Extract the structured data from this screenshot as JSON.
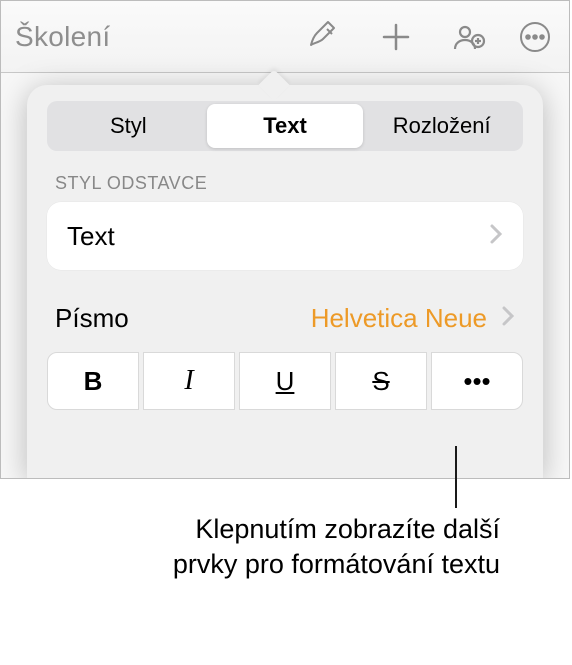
{
  "toolbar": {
    "doc_title": "Školení"
  },
  "popover": {
    "tabs": {
      "style": "Styl",
      "text": "Text",
      "layout": "Rozložení"
    },
    "section_label": "STYL ODSTAVCE",
    "paragraph_style_value": "Text",
    "font_label": "Písmo",
    "font_value": "Helvetica Neue",
    "bold_glyph": "B",
    "italic_glyph": "I",
    "underline_glyph": "U",
    "strike_glyph": "S",
    "more_glyph": "•••"
  },
  "callout": {
    "text": "Klepnutím zobrazíte další prvky pro formátování textu"
  }
}
